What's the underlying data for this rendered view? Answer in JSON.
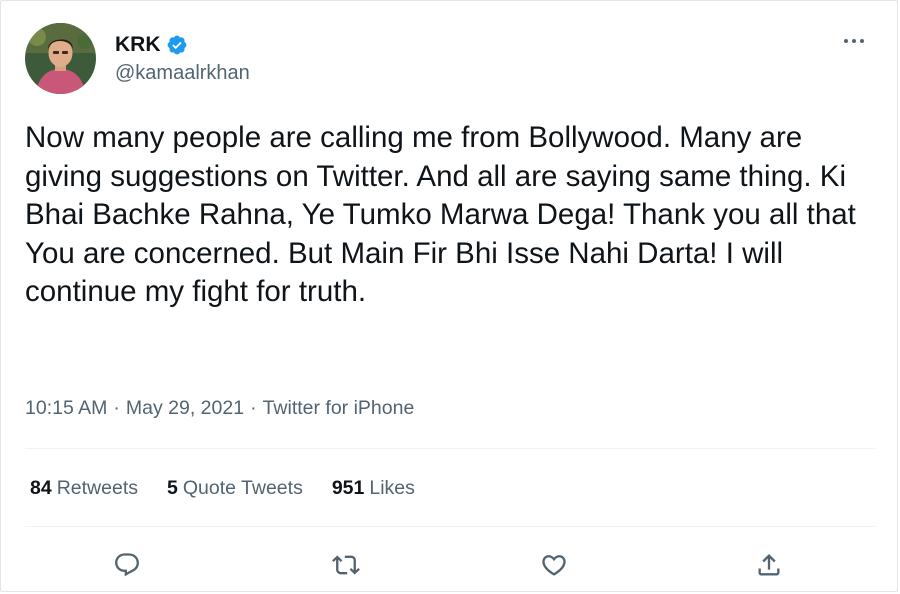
{
  "author": {
    "display_name": "KRK",
    "handle": "@kamaalrkhan",
    "verified": true
  },
  "tweet": {
    "text": "Now many people are calling me from Bollywood. Many are giving suggestions on Twitter. And all are saying same thing. Ki Bhai Bachke Rahna, Ye Tumko Marwa Dega! Thank you all that You are concerned. But Main Fir Bhi Isse Nahi Darta! I will continue my fight for truth.",
    "time": "10:15 AM",
    "date": "May 29, 2021",
    "separator": "·",
    "source": "Twitter for iPhone"
  },
  "stats": {
    "retweets": {
      "count": "84",
      "label": "Retweets"
    },
    "quote_tweets": {
      "count": "5",
      "label": "Quote Tweets"
    },
    "likes": {
      "count": "951",
      "label": "Likes"
    }
  },
  "icons": {
    "more": "more-horizontal-icon",
    "reply": "reply-bubble-icon",
    "retweet": "retweet-icon",
    "like": "heart-icon",
    "share": "share-upload-icon",
    "verified": "verified-badge-icon"
  },
  "colors": {
    "text_primary": "#0f1419",
    "text_secondary": "#536471",
    "verified_blue": "#1d9bf0",
    "divider": "#eff3f4"
  }
}
